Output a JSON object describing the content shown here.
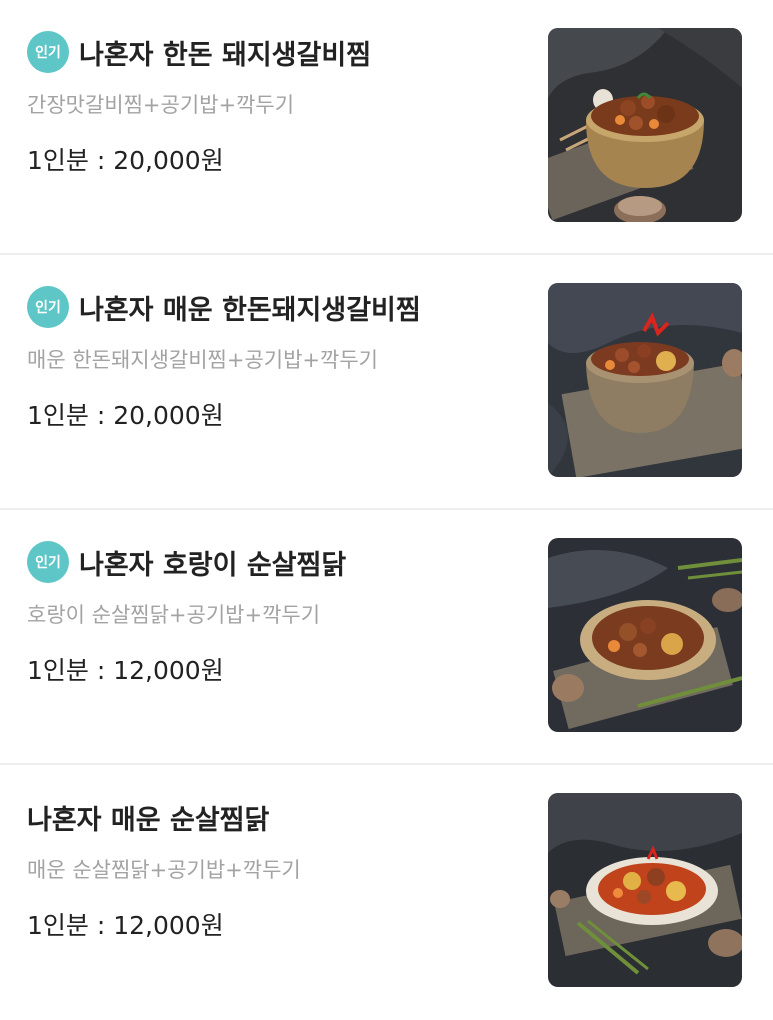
{
  "menu": {
    "items": [
      {
        "badge": "인기",
        "name": "나혼자 한돈 돼지생갈비찜",
        "description": "간장맛갈비찜+공기밥+깍두기",
        "price": "1인분 : 20,000원"
      },
      {
        "badge": "인기",
        "name": "나혼자 매운 한돈돼지생갈비찜",
        "description": "매운 한돈돼지생갈비찜+공기밥+깍두기",
        "price": "1인분 : 20,000원"
      },
      {
        "badge": "인기",
        "name": "나혼자 호랑이 순살찜닭",
        "description": "호랑이 순살찜닭+공기밥+깍두기",
        "price": "1인분 : 12,000원"
      },
      {
        "badge": "",
        "name": "나혼자 매운 순살찜닭",
        "description": "매운 순살찜닭+공기밥+깍두기",
        "price": "1인분 : 12,000원"
      }
    ]
  },
  "colors": {
    "badge": "#5ec6c7",
    "divider": "#eeeeee",
    "description": "#a3a3a3",
    "text": "#222222"
  }
}
